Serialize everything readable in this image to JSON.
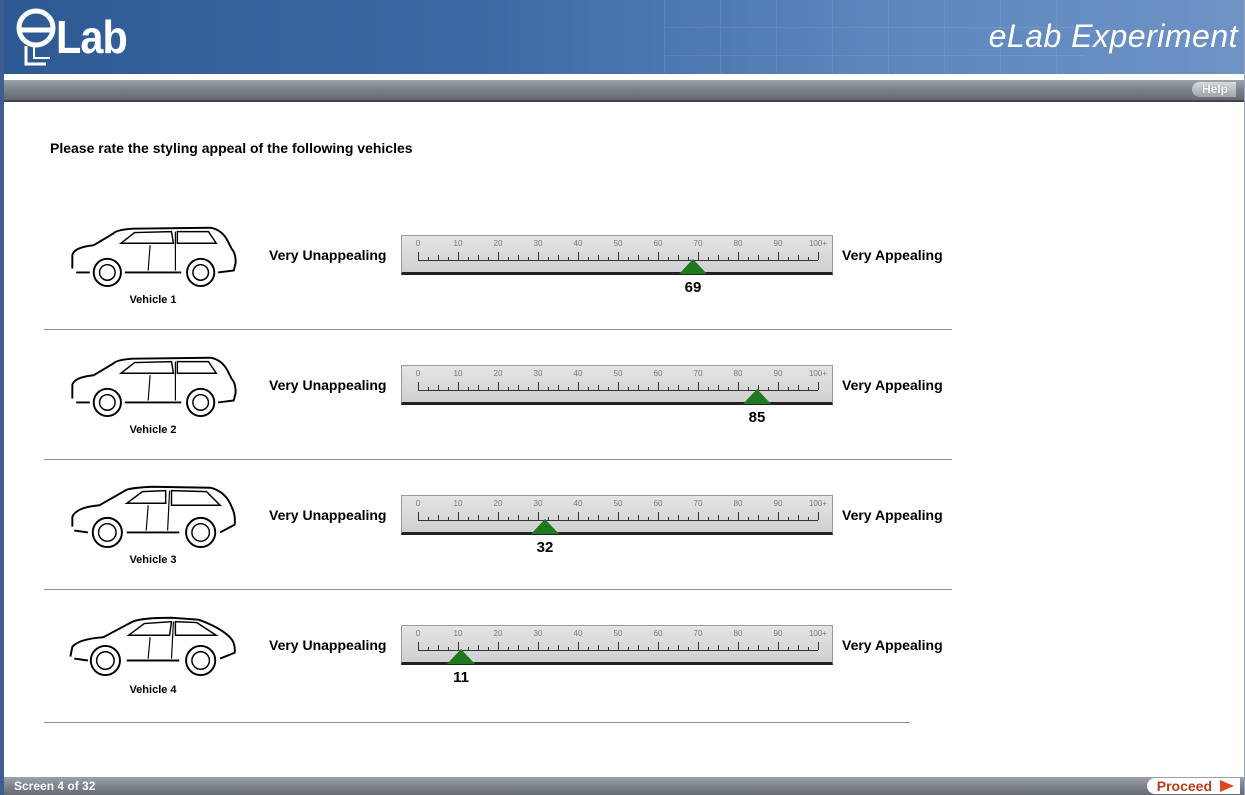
{
  "app": {
    "logo_text": "Lab",
    "title": "eLab Experiment"
  },
  "toolbar": {
    "help_label": "Help"
  },
  "question": "Please rate the styling appeal of the following vehicles",
  "scale": {
    "left_label": "Very Unappealing",
    "right_label": "Very Appealing",
    "tick_labels": [
      "0",
      "10",
      "20",
      "30",
      "40",
      "50",
      "60",
      "70",
      "80",
      "90",
      "100+"
    ],
    "min": 0,
    "max": 100
  },
  "vehicles": [
    {
      "label": "Vehicle 1",
      "value": 69,
      "icon": "suv-icon"
    },
    {
      "label": "Vehicle 2",
      "value": 85,
      "icon": "suv-icon"
    },
    {
      "label": "Vehicle 3",
      "value": 32,
      "icon": "crossover-icon"
    },
    {
      "label": "Vehicle 4",
      "value": 11,
      "icon": "sedan-icon"
    }
  ],
  "footer": {
    "screen_label": "Screen 4 of 32",
    "proceed_label": "Proceed"
  },
  "colors": {
    "header": "#3f6aa5",
    "thumb": "#1f7a1f",
    "proceed": "#c03a1c"
  }
}
